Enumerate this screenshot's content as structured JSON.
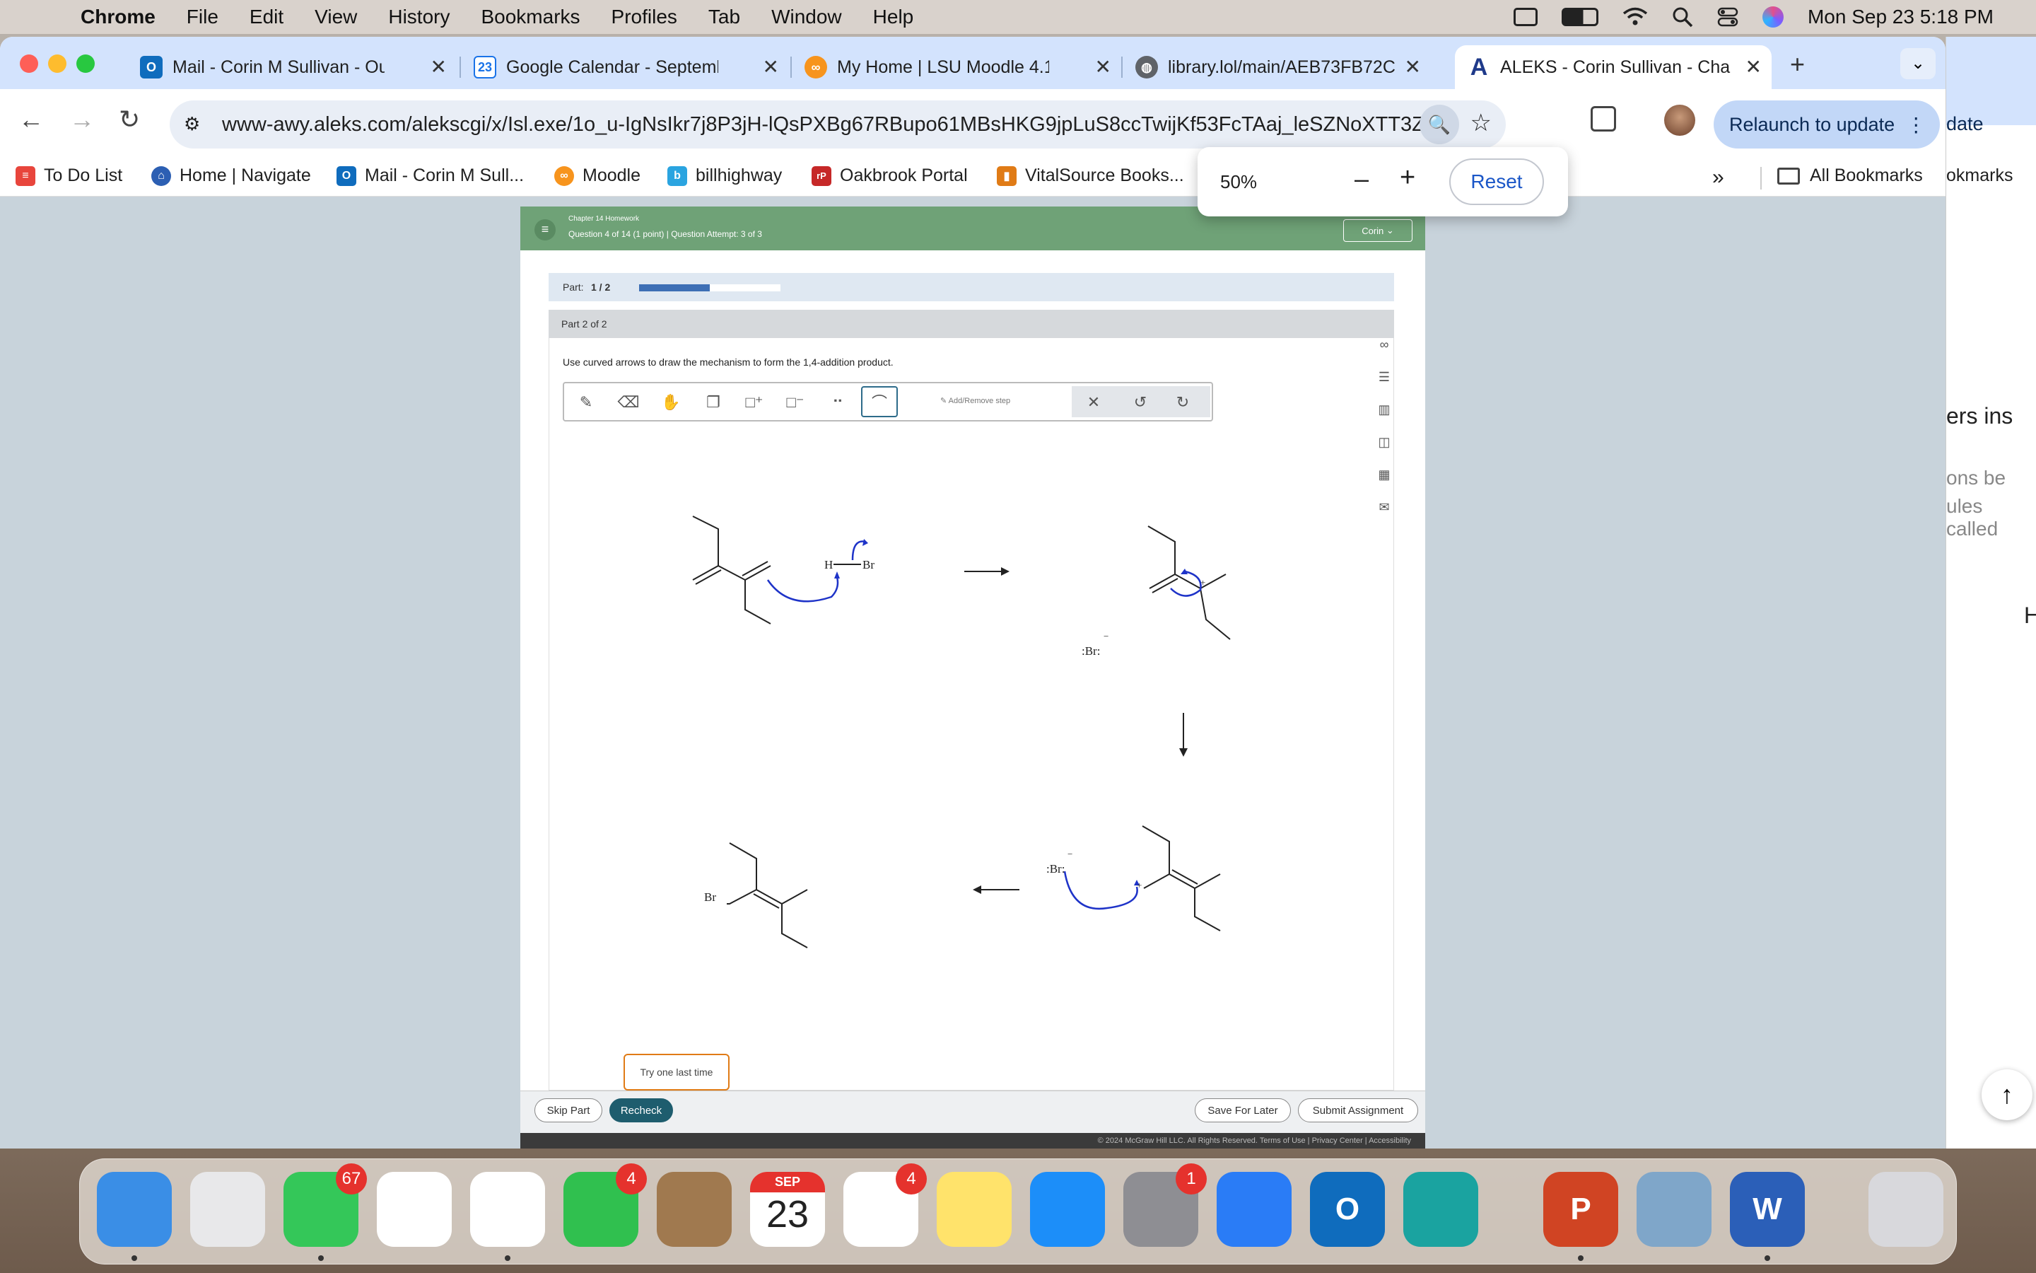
{
  "menubar": {
    "app": "Chrome",
    "items": [
      "File",
      "Edit",
      "View",
      "History",
      "Bookmarks",
      "Profiles",
      "Tab",
      "Window",
      "Help"
    ],
    "datetime": "Mon Sep 23  5:18 PM"
  },
  "tabs": [
    {
      "title": "Mail - Corin M Sullivan - Outl",
      "icon": "outlook-icon",
      "color": "#0f6cbd"
    },
    {
      "title": "Google Calendar - Septembe",
      "icon": "calendar-icon",
      "color": "#1a73e8",
      "glyph": "23"
    },
    {
      "title": "My Home | LSU Moodle 4.1",
      "icon": "moodle-icon",
      "color": "#f7941d"
    },
    {
      "title": "library.lol/main/AEB73FB72C",
      "icon": "globe-icon",
      "color": "#5f6368"
    },
    {
      "title": "ALEKS - Corin Sullivan - Cha",
      "icon": "aleks-icon",
      "color": "#1f3a8a",
      "glyph": "A",
      "active": true
    }
  ],
  "toolbar": {
    "url": "www-awy.aleks.com/alekscgi/x/Isl.exe/1o_u-IgNsIkr7j8P3jH-lQsPXBg67RBupo61MBsHKG9jpLuS8ccTwijKf53FcTAaj_leSZNoXTT3Z...",
    "relaunch": "Relaunch to update",
    "side_peek": "date"
  },
  "bookmarks": [
    {
      "label": "To Do List",
      "color": "#e8453c"
    },
    {
      "label": "Home | Navigate",
      "color": "#2c5fb3"
    },
    {
      "label": "Mail - Corin M Sull...",
      "color": "#0f6cbd"
    },
    {
      "label": "Moodle",
      "color": "#f7941d"
    },
    {
      "label": "billhighway",
      "color": "#2aa4e0",
      "glyph": "b"
    },
    {
      "label": "Oakbrook Portal",
      "color": "#c62828",
      "glyph": "rP"
    },
    {
      "label": "VitalSource Books...",
      "color": "#e07b16"
    }
  ],
  "bookmarks_right": {
    "more": "»",
    "all": "All Bookmarks",
    "peek": "okmarks"
  },
  "zoom": {
    "level": "50%",
    "minus": "–",
    "plus": "+",
    "reset": "Reset"
  },
  "aleks": {
    "chapter": "Chapter 14 Homework",
    "question": "Question 4 of 14 (1 point)  |  Question Attempt: 3 of 3",
    "user": "Corin",
    "part_label": "Part:",
    "part_value": "1 / 2",
    "part_progress": 0.5,
    "part_header": "Part 2 of 2",
    "instruction": "Use curved arrows to draw the mechanism to form the 1,4-addition product.",
    "add_remove": "Add/Remove step",
    "tooltip": "Try one last time",
    "skip": "Skip Part",
    "recheck": "Recheck",
    "save_later": "Save For Later",
    "submit": "Submit Assignment",
    "footer": "© 2024 McGraw Hill LLC. All Rights Reserved.   Terms of Use   |   Privacy Center   |   Accessibility"
  },
  "molecule_labels": {
    "hbr_h": "H",
    "br": "Br",
    "br_anion": ":Br:",
    "br_product": "Br",
    "charge_minus": "−",
    "charge_plus": "+"
  },
  "side_panel_text": {
    "a": "ers ins",
    "b": "ons be",
    "c": "ules called",
    "d": "H"
  },
  "dock": [
    {
      "name": "finder-icon",
      "color": "#3a8ee6"
    },
    {
      "name": "launchpad-icon",
      "color": "#e8e8ea"
    },
    {
      "name": "messages-icon",
      "color": "#34c759",
      "badge": "67"
    },
    {
      "name": "chrome-icon",
      "color": "#ffffff"
    },
    {
      "name": "photos-icon",
      "color": "#ffffff"
    },
    {
      "name": "facetime-icon",
      "color": "#30c04f",
      "badge": "4"
    },
    {
      "name": "contacts-icon",
      "color": "#a0794f"
    },
    {
      "name": "calendar-icon",
      "color": "#ffffff",
      "month": "SEP",
      "day": "23"
    },
    {
      "name": "reminders-icon",
      "color": "#ffffff",
      "badge": "4"
    },
    {
      "name": "notes-icon",
      "color": "#ffe36b"
    },
    {
      "name": "app-store-icon",
      "color": "#1c8ef9"
    },
    {
      "name": "system-settings-icon",
      "color": "#8e8e93",
      "badge": "1"
    },
    {
      "name": "keynote-icon",
      "color": "#2a7cf6"
    },
    {
      "name": "outlook-icon",
      "color": "#0f6cbd",
      "glyph": "O"
    },
    {
      "name": "edge-icon",
      "color": "#1aa3a0"
    },
    {
      "name": "powerpoint-icon",
      "color": "#d04423",
      "glyph": "P"
    },
    {
      "name": "preview-icon",
      "color": "#7fa6c9"
    },
    {
      "name": "word-icon",
      "color": "#2b5fb8",
      "glyph": "W"
    },
    {
      "name": "trash-icon",
      "color": "#d8d8dc"
    }
  ]
}
